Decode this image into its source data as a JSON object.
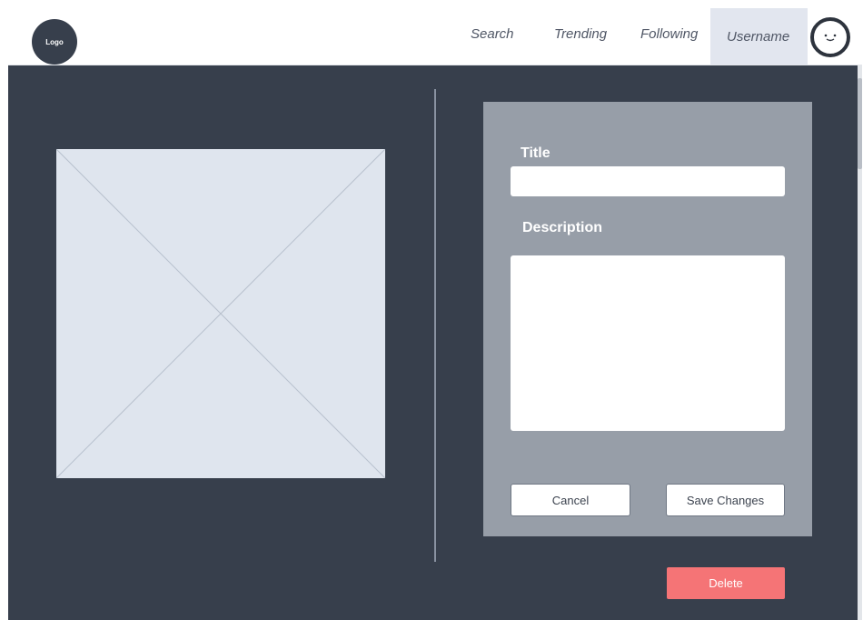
{
  "header": {
    "logo_text": "Logo",
    "nav": {
      "search": "Search",
      "trending": "Trending",
      "following": "Following",
      "username": "Username"
    },
    "avatar_icon": "smiley-face-icon"
  },
  "media": {
    "icon": "image-placeholder-icon"
  },
  "form": {
    "title_label": "Title",
    "title_value": "",
    "description_label": "Description",
    "description_value": "",
    "cancel_label": "Cancel",
    "save_label": "Save Changes"
  },
  "actions": {
    "delete_label": "Delete"
  },
  "colors": {
    "page_background": "#373f4c",
    "panel": "#979ea8",
    "delete": "#f57476",
    "active_nav": "#e2e6ef"
  }
}
